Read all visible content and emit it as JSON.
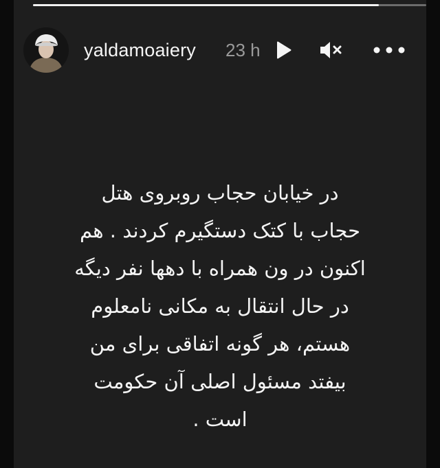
{
  "story": {
    "progress": 0.88,
    "colors": {
      "background": "#1e1e1e",
      "text": "#f4f4f4",
      "muted_text": "#9a9a9a"
    }
  },
  "header": {
    "username": "yaldamoaiery",
    "timestamp": "23 h",
    "icons": [
      "avatar-photo",
      "play-icon",
      "mute-icon",
      "more-options-icon"
    ]
  },
  "post": {
    "lines": [
      "در خیابان حجاب روبروی هتل",
      "حجاب با کتک دستگیرم کردند . هم",
      "اکنون در ون همراه با دهها نفر دیگه",
      "در حال انتقال به مکانی نامعلوم",
      "هستم، هر گونه اتفاقی برای من",
      "بیفتد مسئول اصلی آن حکومت",
      "است ."
    ]
  }
}
